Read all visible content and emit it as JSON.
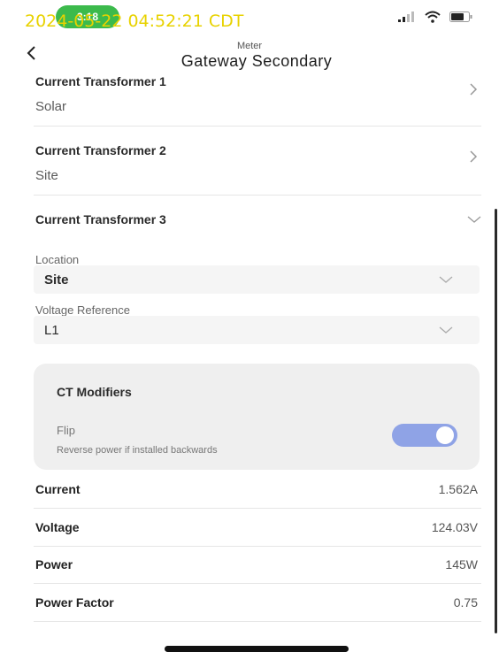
{
  "status_bar": {
    "time": "3:18",
    "timestamp": "2024-05-22 04:52:21 CDT",
    "icons": [
      "signal-icon",
      "wifi-icon",
      "battery-icon"
    ]
  },
  "header": {
    "subtitle": "Meter",
    "title": "Gateway Secondary"
  },
  "transformers": [
    {
      "label": "Current Transformer 1",
      "value": "Solar"
    },
    {
      "label": "Current Transformer 2",
      "value": "Site"
    },
    {
      "label": "Current Transformer 3",
      "value": ""
    }
  ],
  "ct3": {
    "location_label": "Location",
    "location_value": "Site",
    "voltage_ref_label": "Voltage Reference",
    "voltage_ref_value": "L1"
  },
  "modifiers": {
    "title": "CT Modifiers",
    "flip_label": "Flip",
    "flip_description": "Reverse power if installed backwards",
    "flip_enabled": true
  },
  "metrics": [
    {
      "label": "Current",
      "value": "1.562A"
    },
    {
      "label": "Voltage",
      "value": "124.03V"
    },
    {
      "label": "Power",
      "value": "145W"
    },
    {
      "label": "Power Factor",
      "value": "0.75"
    }
  ],
  "colors": {
    "accent": "#8fa3e6",
    "status_pill": "#3cba4c",
    "timestamp": "#e8d200"
  }
}
